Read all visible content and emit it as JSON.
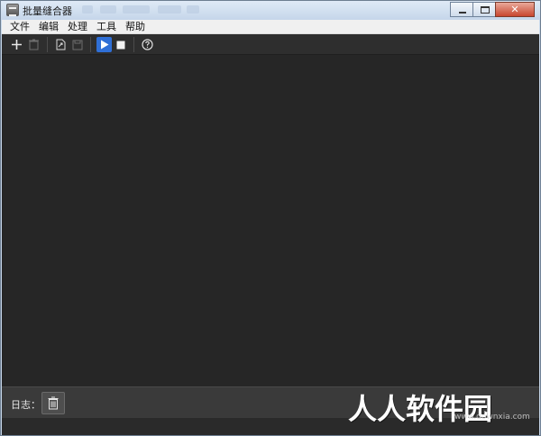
{
  "window": {
    "title": "批量缝合器"
  },
  "menu": {
    "items": [
      "文件",
      "编辑",
      "处理",
      "工具",
      "帮助"
    ]
  },
  "toolbar": {
    "buttons": [
      "add-icon",
      "delete-icon",
      "open-file-icon",
      "save-icon",
      "play-icon",
      "stop-icon",
      "help-icon"
    ]
  },
  "log": {
    "label": "日志："
  },
  "watermark": {
    "text": "人人软件园",
    "url": "www.downxia.com"
  },
  "colors": {
    "workspace": "#262626",
    "toolbar": "#2e2e2e",
    "accent": "#2f6fd6"
  }
}
